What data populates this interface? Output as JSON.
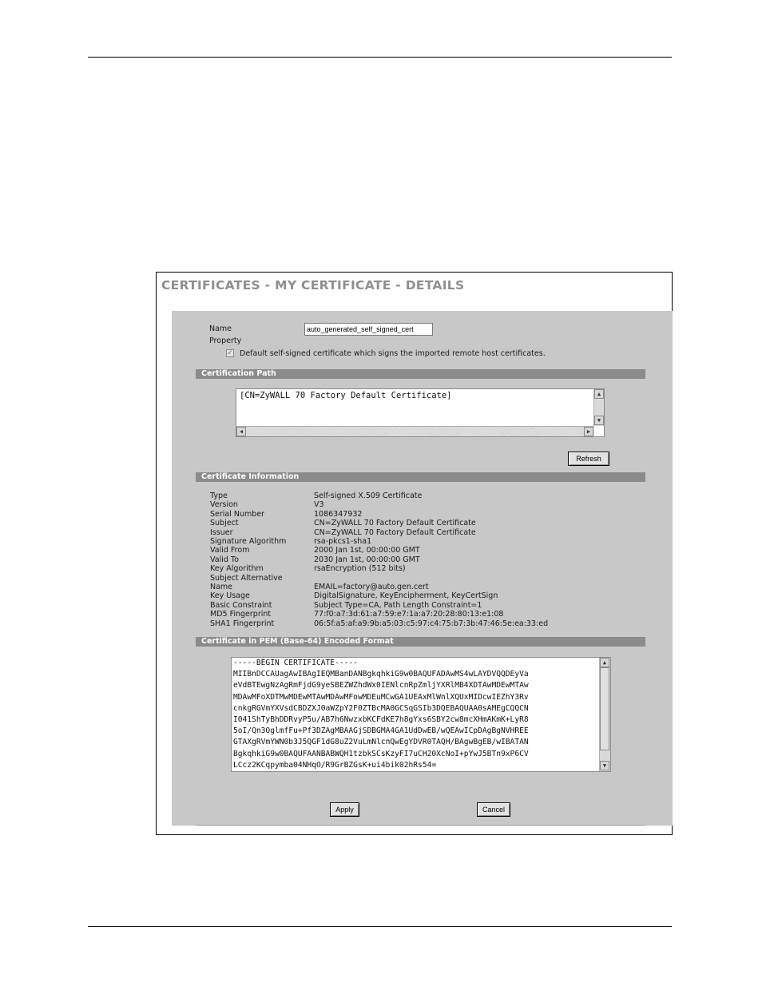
{
  "page": {
    "title": "CERTIFICATES - MY CERTIFICATE - DETAILS"
  },
  "form": {
    "name_label": "Name",
    "name_value": "auto_generated_self_signed_cert",
    "property_label": "Property",
    "default_checkbox_label": "Default self-signed certificate which signs the imported remote host certificates.",
    "default_checkbox_checked": true
  },
  "certification_path": {
    "header": "Certification Path",
    "entries": [
      "[CN=ZyWALL 70 Factory Default Certificate]"
    ],
    "refresh_label": "Refresh"
  },
  "certificate_information": {
    "header": "Certificate Information",
    "rows": [
      {
        "key": "Type",
        "value": "Self-signed X.509 Certificate"
      },
      {
        "key": "Version",
        "value": "V3"
      },
      {
        "key": "Serial Number",
        "value": "1086347932"
      },
      {
        "key": "Subject",
        "value": "CN=ZyWALL 70 Factory Default Certificate"
      },
      {
        "key": "Issuer",
        "value": "CN=ZyWALL 70 Factory Default Certificate"
      },
      {
        "key": "Signature Algorithm",
        "value": "rsa-pkcs1-sha1"
      },
      {
        "key": "Valid From",
        "value": "2000 Jan 1st, 00:00:00 GMT"
      },
      {
        "key": "Valid To",
        "value": "2030 Jan 1st, 00:00:00 GMT"
      },
      {
        "key": "Key Algorithm",
        "value": "rsaEncryption (512 bits)"
      },
      {
        "key": "Subject Alternative",
        "key2": "Name",
        "value": "EMAIL=factory@auto.gen.cert"
      },
      {
        "key": "Key Usage",
        "value": "DigitalSignature, KeyEncipherment, KeyCertSign"
      },
      {
        "key": "Basic Constraint",
        "value": "Subject Type=CA, Path Length Constraint=1"
      },
      {
        "key": "MD5 Fingerprint",
        "value": "77:f0:a7:3d:61:a7:59:e7:1a:a7:20:28:80:13:e1:08"
      },
      {
        "key": "SHA1 Fingerprint",
        "value": "06:5f:a5:af:a9:9b:a5:03:c5:97:c4:75:b7:3b:47:46:5e:ea:33:ed"
      }
    ]
  },
  "pem": {
    "header": "Certificate in PEM (Base-64) Encoded Format",
    "lines": [
      "-----BEGIN CERTIFICATE-----",
      "MIIBnDCCAUagAwIBAgIEQMBanDANBgkqhkiG9w0BAQUFADAwMS4wLAYDVQQDEyVa",
      "eVdBTEwgNzAgRmFjdG9yeSBEZWZhdWx0IENlcnRpZmljYXRlMB4XDTAwMDEwMTAw",
      "MDAwMFoXDTMwMDEwMTAwMDAwMFowMDEuMCwGA1UEAxMlWnlXQUxMIDcwIEZhY3Rv",
      "cnkgRGVmYXVsdCBDZXJ0aWZpY2F0ZTBcMA0GCSqGSIb3DQEBAQUAA0sAMEgCQQCN",
      "I041ShTyBhDDRvyP5u/AB7h6NwzxbKCFdKE7h8gYxs6SBY2cw8mcXHmAKmK+LyR8",
      "5oI/Qn3OglmfFu+Pf3DZAgMBAAGjSDBGMA4GA1UdDwEB/wQEAwICpDAgBgNVHREE",
      "GTAXgRVmYWN0b3J5QGF1dG8uZ2VuLmNlcnQwEgYDVR0TAQH/BAgwBgEB/wIBATAN",
      "BgkqhkiG9w0BAQUFAANBABWQH1tzbkSCsKzyFI7uCH20XcNoI+pYwJ5BTn9xP6CV",
      "LCcz2KCqpymba04NHqO/R9GrBZGsK+ui4bik02hRs54="
    ]
  },
  "actions": {
    "apply_label": "Apply",
    "cancel_label": "Cancel"
  }
}
